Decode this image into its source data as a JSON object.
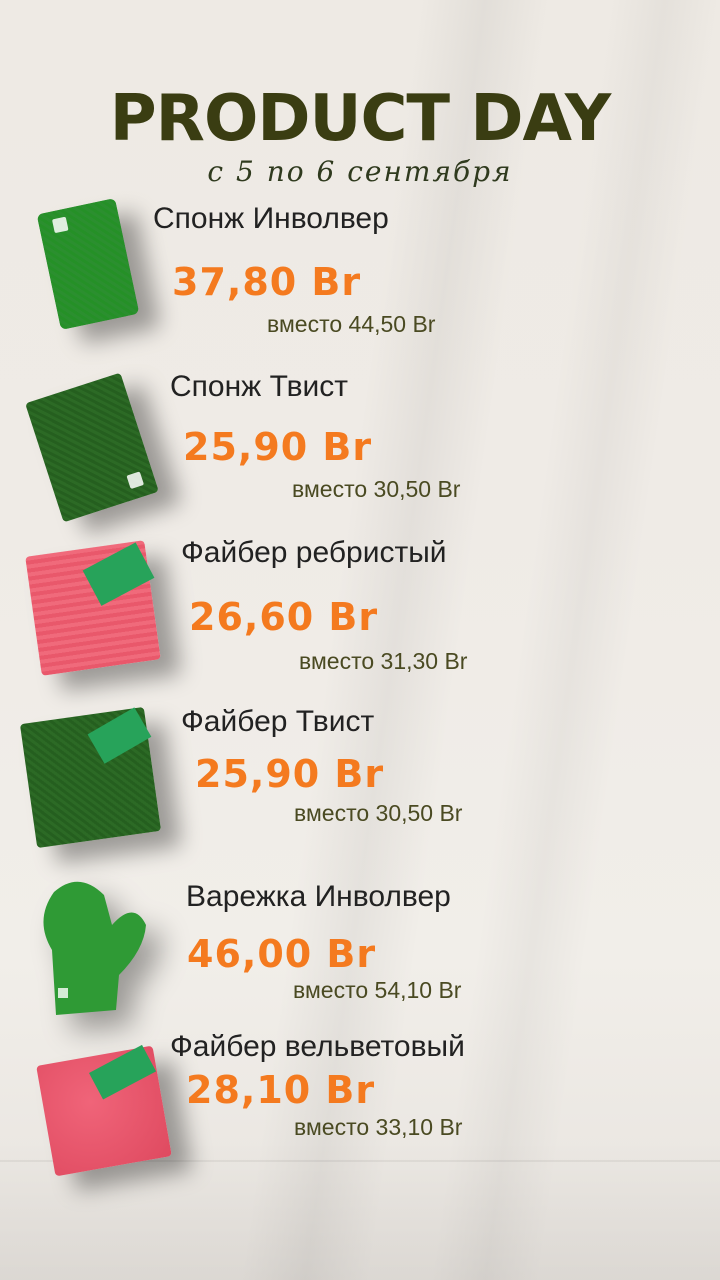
{
  "title": "PRODUCT DAY",
  "subtitle": "с 5 по 6 сентября",
  "products": [
    {
      "name": "Спонж Инволвер",
      "price": "37,80 Br",
      "old_price": "вместо 44,50 Br"
    },
    {
      "name": "Спонж Твист",
      "price": "25,90 Br",
      "old_price": "вместо 30,50 Br"
    },
    {
      "name": "Файбер ребристый",
      "price": "26,60 Br",
      "old_price": "вместо 31,30 Br"
    },
    {
      "name": "Файбер Твист",
      "price": "25,90 Br",
      "old_price": "вместо 30,50 Br"
    },
    {
      "name": "Варежка Инволвер",
      "price": "46,00 Br",
      "old_price": "вместо 54,10 Br"
    },
    {
      "name": "Файбер вельветовый",
      "price": "28,10 Br",
      "old_price": "вместо 33,10 Br"
    }
  ]
}
